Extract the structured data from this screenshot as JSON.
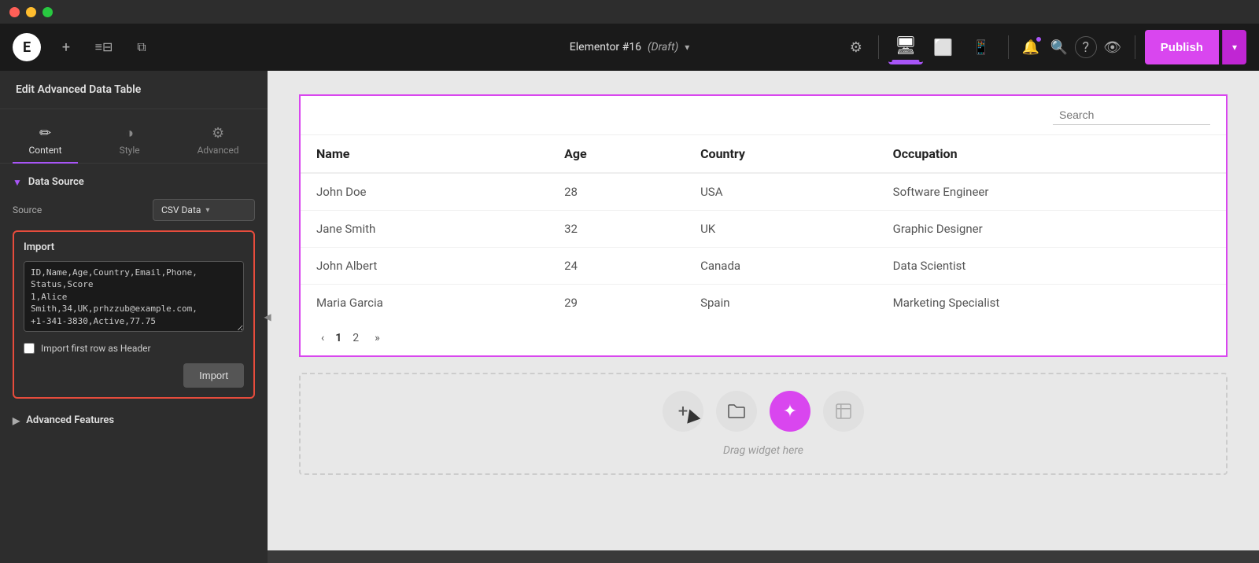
{
  "titlebar": {
    "traffic_lights": [
      "red",
      "yellow",
      "green"
    ]
  },
  "topnav": {
    "logo_text": "E",
    "add_icon": "+",
    "sliders_icon": "⚙",
    "layers_icon": "⧉",
    "title": "Elementor #16",
    "draft_label": "(Draft)",
    "arrow_icon": "▾",
    "settings_icon": "⚙",
    "desktop_icon": "🖥",
    "tablet_icon": "📱",
    "mobile_icon": "📱",
    "notification_icon": "🔔",
    "search_icon": "🔍",
    "help_icon": "?",
    "preview_icon": "👁",
    "publish_label": "Publish",
    "publish_arrow": "▾"
  },
  "sidebar": {
    "title": "Edit Advanced Data Table",
    "tabs": [
      {
        "id": "content",
        "label": "Content",
        "icon": "✏"
      },
      {
        "id": "style",
        "label": "Style",
        "icon": "◑"
      },
      {
        "id": "advanced",
        "label": "Advanced",
        "icon": "⚙"
      }
    ],
    "active_tab": "content",
    "data_source": {
      "section_label": "Data Source",
      "source_label": "Source",
      "source_value": "CSV Data",
      "import_section": {
        "label": "Import",
        "textarea_value": "ID,Name,Age,Country,Email,Phone,Status,Score\n1,Alice\nSmith,34,UK,prhzzub@example.com,\n+1-341-3830,Active,77.75",
        "checkbox_label": "Import first row as Header",
        "checkbox_checked": false,
        "button_label": "Import"
      }
    },
    "advanced_features": {
      "label": "Advanced Features"
    }
  },
  "canvas": {
    "search_placeholder": "Search",
    "table": {
      "headers": [
        "Name",
        "Age",
        "Country",
        "Occupation"
      ],
      "rows": [
        [
          "John Doe",
          "28",
          "USA",
          "Software Engineer"
        ],
        [
          "Jane Smith",
          "32",
          "UK",
          "Graphic Designer"
        ],
        [
          "John Albert",
          "24",
          "Canada",
          "Data Scientist"
        ],
        [
          "Maria Garcia",
          "29",
          "Spain",
          "Marketing Specialist"
        ]
      ],
      "pagination": {
        "prev": "‹",
        "pages": [
          "1",
          "2"
        ],
        "next": "»",
        "active_page": "1"
      }
    },
    "dropzone": {
      "text": "Drag widget here",
      "buttons": [
        {
          "id": "add",
          "icon": "+",
          "primary": false
        },
        {
          "id": "folder",
          "icon": "📁",
          "primary": false
        },
        {
          "id": "ai",
          "icon": "✦",
          "primary": true
        },
        {
          "id": "template",
          "icon": "⊡",
          "primary": false
        }
      ]
    }
  }
}
